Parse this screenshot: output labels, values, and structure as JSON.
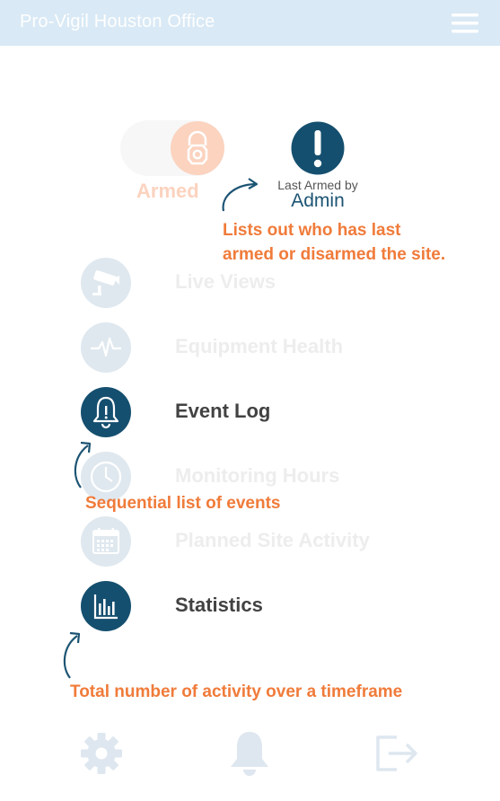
{
  "header": {
    "title": "Pro-Vigil Houston Office",
    "menu_icon": "hamburger-menu-icon"
  },
  "arm": {
    "state_label": "Armed",
    "icon": "lock-icon",
    "last_armed_label": "Last Armed by",
    "last_armed_user": "Admin",
    "alert_icon": "exclamation-icon"
  },
  "menu": [
    {
      "label": "Live Views",
      "icon": "camera-icon",
      "active": false
    },
    {
      "label": "Equipment Health",
      "icon": "heartbeat-icon",
      "active": false
    },
    {
      "label": "Event Log",
      "icon": "bell-icon",
      "active": true
    },
    {
      "label": "Monitoring Hours",
      "icon": "clock-icon",
      "active": false
    },
    {
      "label": "Planned Site Activity",
      "icon": "calendar-icon",
      "active": false
    },
    {
      "label": "Statistics",
      "icon": "bar-chart-icon",
      "active": true
    }
  ],
  "annotations": {
    "last_armed_line1": "Lists out who has last",
    "last_armed_line2": "armed or disarmed the site.",
    "event_log": "Sequential list of events",
    "statistics": "Total number of activity over a timeframe"
  },
  "bottom_bar": {
    "settings_icon": "gear-icon",
    "notifications_icon": "bell-icon",
    "logout_icon": "logout-icon"
  },
  "colors": {
    "header_bg": "#d9e9f5",
    "accent_orange": "#f07b3a",
    "primary_navy": "#154f6f",
    "inactive_icon_bg": "#dfe8ef"
  }
}
